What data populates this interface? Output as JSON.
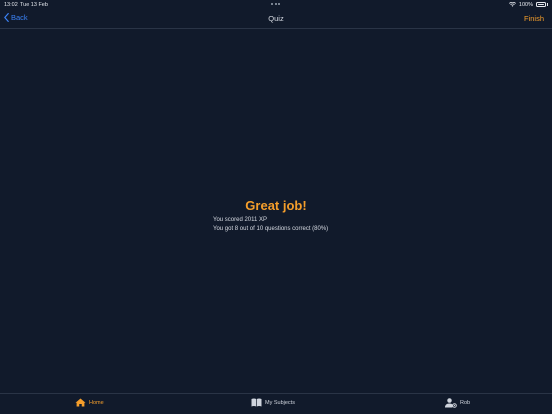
{
  "status_bar": {
    "time": "13:02",
    "date": "Tue 13 Feb",
    "battery": "100%"
  },
  "nav": {
    "back_label": "Back",
    "title": "Quiz",
    "finish_label": "Finish"
  },
  "result": {
    "title": "Great job!",
    "score_line": "You scored 2011 XP",
    "correct_line": "You got 8 out of 10 questions correct (80%)"
  },
  "tabs": [
    {
      "label": "Home",
      "icon": "home-icon",
      "active": true
    },
    {
      "label": "My Subjects",
      "icon": "book-icon",
      "active": false
    },
    {
      "label": "Rob",
      "icon": "user-settings-icon",
      "active": false
    }
  ],
  "colors": {
    "background": "#111a2b",
    "accent": "#f59e2b",
    "link": "#3b82f6"
  }
}
